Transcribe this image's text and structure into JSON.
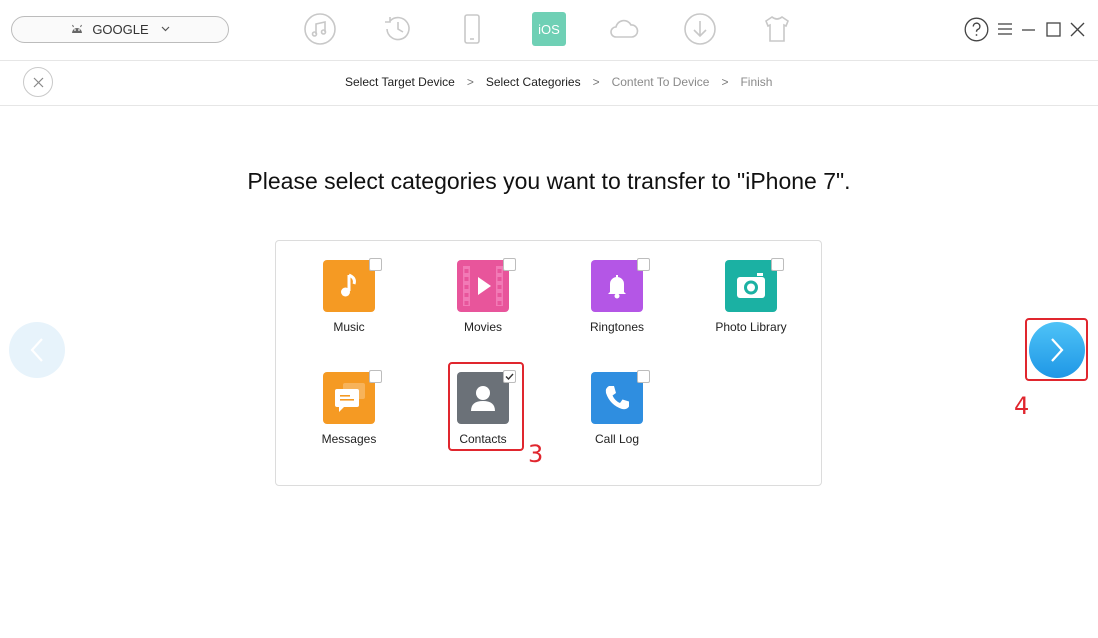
{
  "toolbar": {
    "device_name": "GOOGLE",
    "ios_label": "iOS",
    "tools": [
      "music-icon",
      "history-icon",
      "phone-icon",
      "ios-icon",
      "cloud-icon",
      "download-icon",
      "tshirt-icon"
    ]
  },
  "steps": {
    "items": [
      {
        "label": "Select Target Device",
        "active": true
      },
      {
        "label": "Select Categories",
        "active": true
      },
      {
        "label": "Content To Device",
        "active": false
      },
      {
        "label": "Finish",
        "active": false
      }
    ],
    "separator": ">"
  },
  "main": {
    "heading": "Please select categories you want to transfer to \"iPhone 7\"."
  },
  "categories": [
    {
      "label": "Music",
      "checked": false,
      "color": "#f59a23"
    },
    {
      "label": "Movies",
      "checked": false,
      "color": "#e8559b"
    },
    {
      "label": "Ringtones",
      "checked": false,
      "color": "#b456e6"
    },
    {
      "label": "Photo Library",
      "checked": false,
      "color": "#1bb1a3"
    },
    {
      "label": "Messages",
      "checked": false,
      "color": "#f59a23"
    },
    {
      "label": "Contacts",
      "checked": true,
      "color": "#6b7178"
    },
    {
      "label": "Call Log",
      "checked": false,
      "color": "#2f8ee0"
    }
  ],
  "annotations": {
    "contacts_number": "3",
    "next_number": "4",
    "color": "#e0262e"
  },
  "colors": {
    "accent": "#1f97e6",
    "ios_green": "#6fd0b5"
  }
}
